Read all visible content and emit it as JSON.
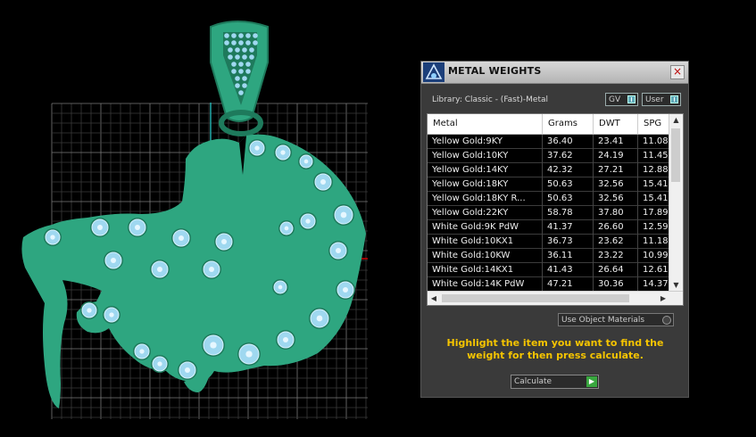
{
  "viewport": {
    "colors": {
      "model": "#2ea680",
      "model_dark": "#1e7a5c",
      "gem": "#9fd8f0",
      "grid": "#6a6a6a"
    }
  },
  "panel": {
    "title": "METAL WEIGHTS",
    "close_icon": "close-icon",
    "library_label": "Library: Classic - (Fast)-Metal",
    "gv_label": "GV",
    "user_label": "User",
    "table": {
      "headers": [
        "Metal",
        "Grams",
        "DWT",
        "SPG"
      ],
      "rows": [
        [
          "Yellow Gold:9KY",
          "36.40",
          "23.41",
          "11.08"
        ],
        [
          "Yellow Gold:10KY",
          "37.62",
          "24.19",
          "11.45"
        ],
        [
          "Yellow Gold:14KY",
          "42.32",
          "27.21",
          "12.88"
        ],
        [
          "Yellow Gold:18KY",
          "50.63",
          "32.56",
          "15.41"
        ],
        [
          "Yellow Gold:18KY R...",
          "50.63",
          "32.56",
          "15.41"
        ],
        [
          "Yellow Gold:22KY",
          "58.78",
          "37.80",
          "17.89"
        ],
        [
          "White Gold:9K PdW",
          "41.37",
          "26.60",
          "12.59"
        ],
        [
          "White Gold:10KX1",
          "36.73",
          "23.62",
          "11.18"
        ],
        [
          "White Gold:10KW",
          "36.11",
          "23.22",
          "10.99"
        ],
        [
          "White Gold:14KX1",
          "41.43",
          "26.64",
          "12.61"
        ],
        [
          "White Gold:14K PdW",
          "47.21",
          "30.36",
          "14.37"
        ]
      ]
    },
    "use_object_materials": "Use Object Materials",
    "instructions": "Highlight the item you want to find the weight for then press calculate.",
    "calculate_label": "Calculate"
  }
}
